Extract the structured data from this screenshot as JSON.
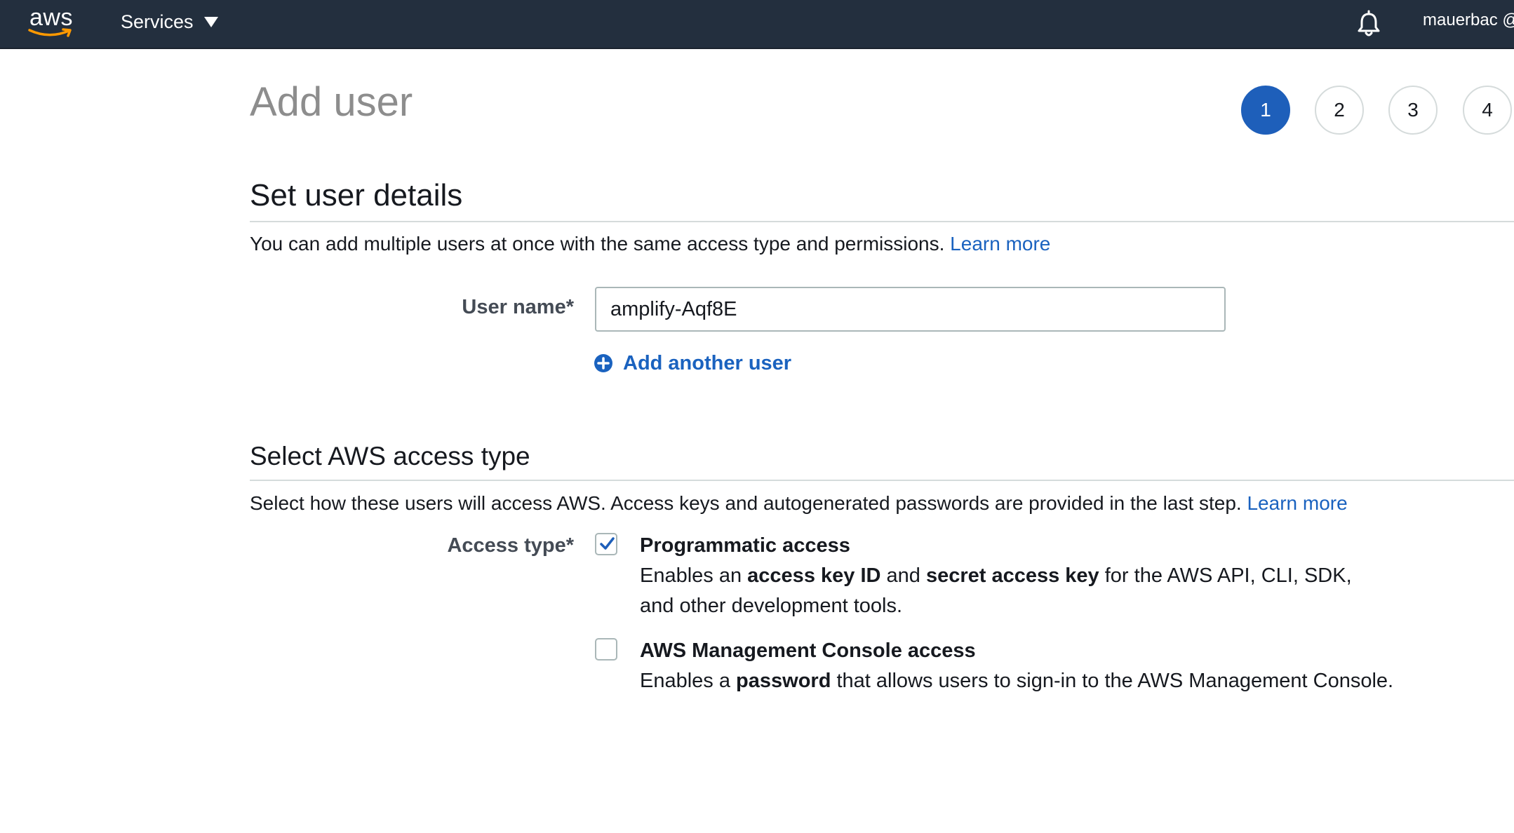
{
  "nav": {
    "logo_text": "aws",
    "services_label": "Services",
    "user_label": "mauerbac @"
  },
  "page": {
    "title": "Add user"
  },
  "steps": [
    "1",
    "2",
    "3",
    "4"
  ],
  "details": {
    "heading": "Set user details",
    "description": "You can add multiple users at once with the same access type and permissions.",
    "learn_more": "Learn more",
    "username_label": "User name*",
    "username_value": "amplify-Aqf8E",
    "add_another_label": "Add another user"
  },
  "access": {
    "heading": "Select AWS access type",
    "description": "Select how these users will access AWS. Access keys and autogenerated passwords are provided in the last step.",
    "learn_more": "Learn more",
    "label": "Access type*",
    "programmatic": {
      "title": "Programmatic access",
      "checked": true,
      "desc_1": "Enables an ",
      "desc_bold_1": "access key ID",
      "desc_2": " and ",
      "desc_bold_2": "secret access key",
      "desc_3": " for the AWS API, CLI, SDK, and other development tools."
    },
    "console": {
      "title": "AWS Management Console access",
      "checked": false,
      "desc_1": "Enables a ",
      "desc_bold_1": "password",
      "desc_2": " that allows users to sign-in to the AWS Management Console."
    }
  },
  "colors": {
    "nav_bg": "#232f3e",
    "accent": "#1e5fba",
    "link": "#1a62bf"
  }
}
